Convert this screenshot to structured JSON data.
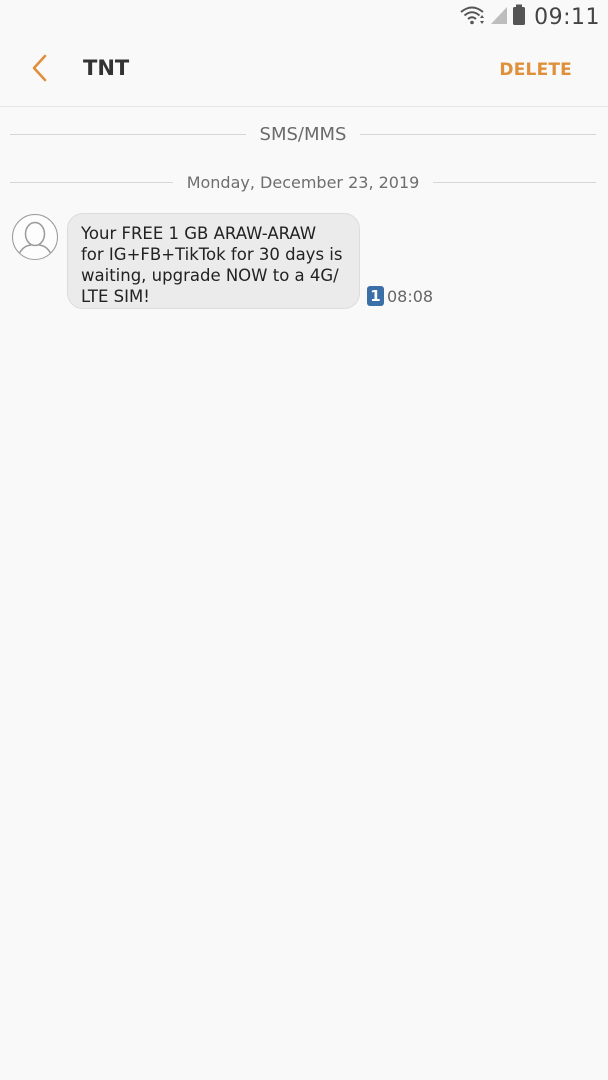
{
  "status_bar": {
    "time": "09:11",
    "icons": [
      "wifi-icon",
      "signal-icon",
      "battery-icon"
    ]
  },
  "app_bar": {
    "back_icon": "chevron-left-icon",
    "title": "TNT",
    "delete_label": "DELETE"
  },
  "conversation": {
    "channel_label": "SMS/MMS",
    "date_label": "Monday, December 23, 2019",
    "messages": [
      {
        "text": "Your FREE 1 GB ARAW-ARAW\nfor IG+FB+TikTok for 30 days is\nwaiting, upgrade NOW to a 4G/\nLTE SIM!",
        "sim": "1",
        "time": "08:08",
        "avatar_icon": "contact-avatar-icon"
      }
    ]
  },
  "colors": {
    "accent": "#e0903a",
    "background": "#f9f9f9",
    "bubble": "#ebebeb",
    "sim_badge": "#3b6fa8"
  }
}
